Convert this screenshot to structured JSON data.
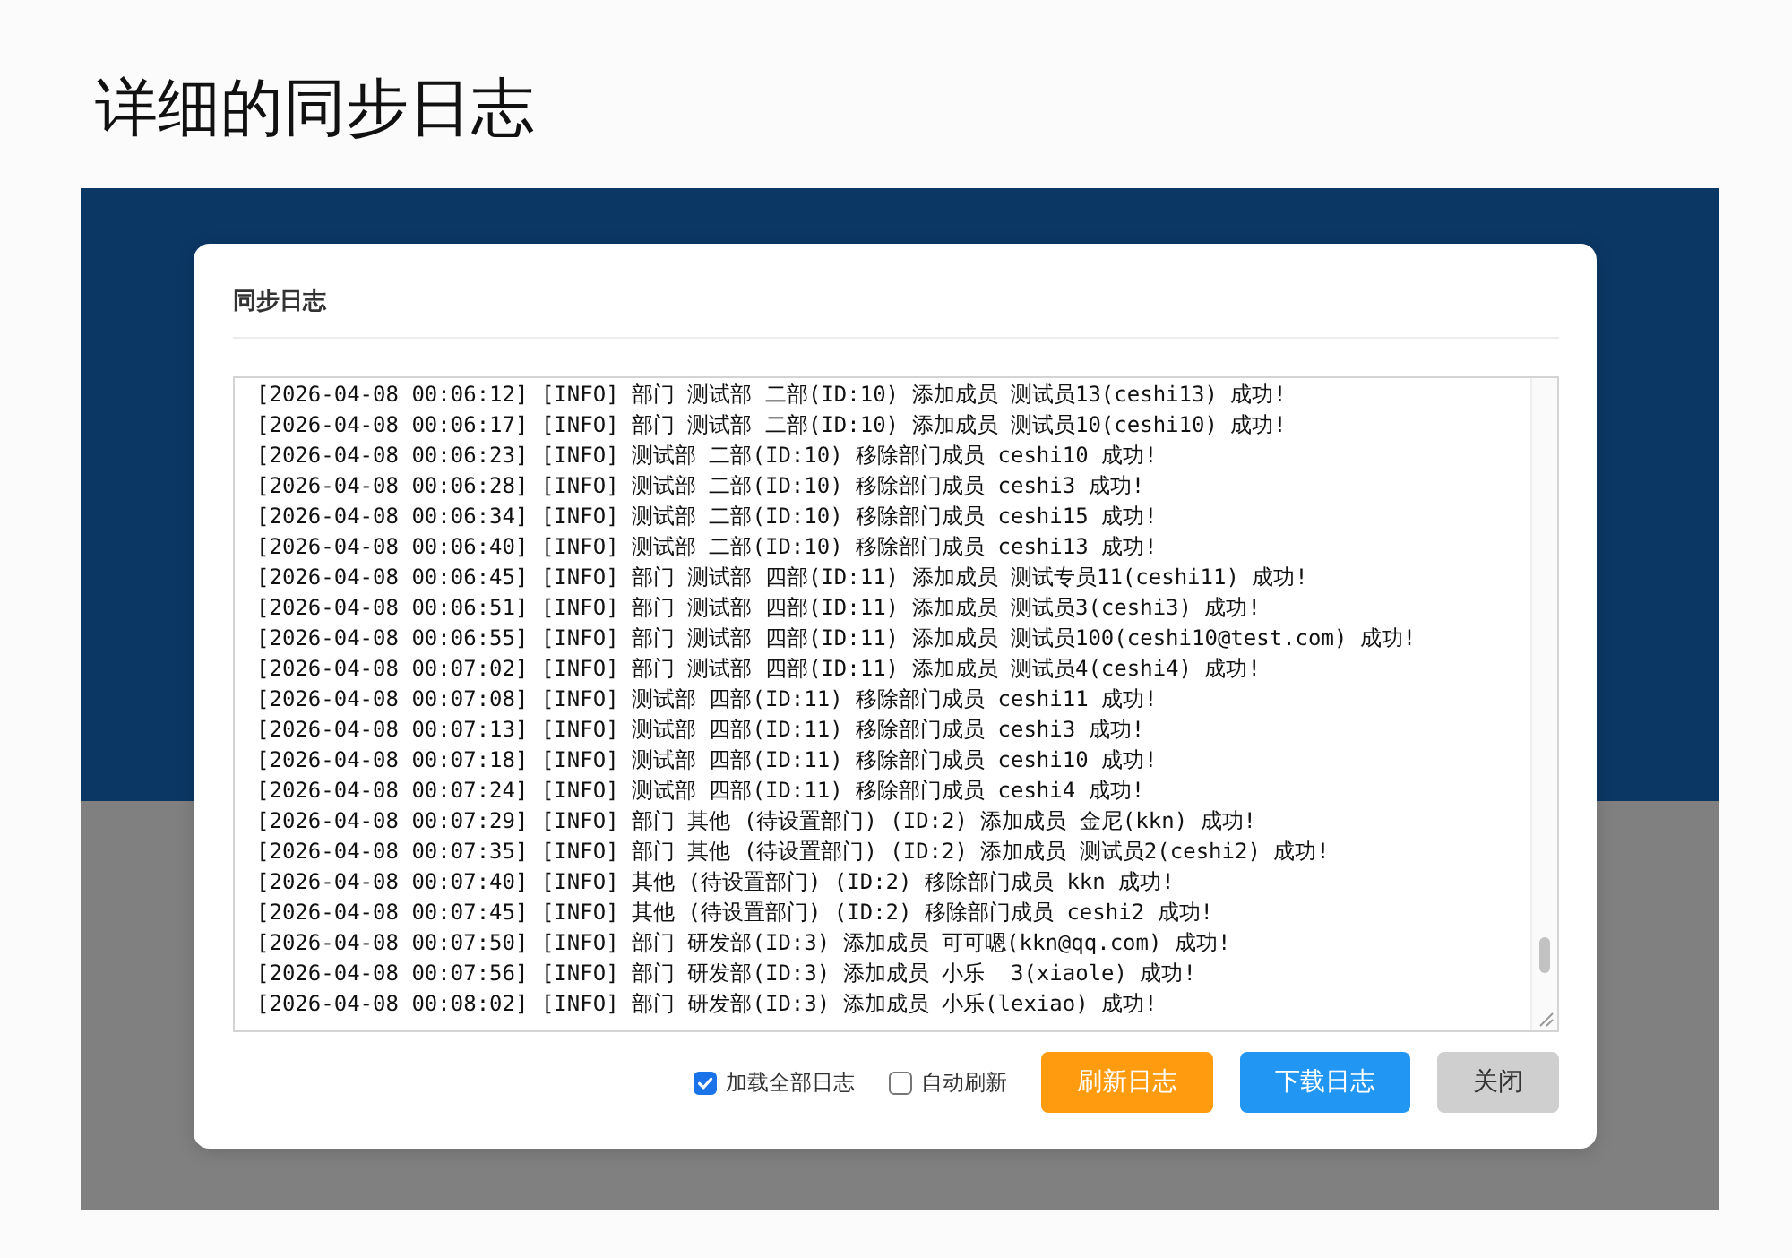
{
  "page_title": "详细的同步日志",
  "dialog": {
    "title": "同步日志",
    "log_lines": [
      "[2026-04-08 00:06:12] [INFO] 部门 测试部 二部(ID:10) 添加成员 测试员13(ceshi13) 成功!",
      "[2026-04-08 00:06:17] [INFO] 部门 测试部 二部(ID:10) 添加成员 测试员10(ceshi10) 成功!",
      "[2026-04-08 00:06:23] [INFO] 测试部 二部(ID:10) 移除部门成员 ceshi10 成功!",
      "[2026-04-08 00:06:28] [INFO] 测试部 二部(ID:10) 移除部门成员 ceshi3 成功!",
      "[2026-04-08 00:06:34] [INFO] 测试部 二部(ID:10) 移除部门成员 ceshi15 成功!",
      "[2026-04-08 00:06:40] [INFO] 测试部 二部(ID:10) 移除部门成员 ceshi13 成功!",
      "[2026-04-08 00:06:45] [INFO] 部门 测试部 四部(ID:11) 添加成员 测试专员11(ceshi11) 成功!",
      "[2026-04-08 00:06:51] [INFO] 部门 测试部 四部(ID:11) 添加成员 测试员3(ceshi3) 成功!",
      "[2026-04-08 00:06:55] [INFO] 部门 测试部 四部(ID:11) 添加成员 测试员100(ceshi10@test.com) 成功!",
      "[2026-04-08 00:07:02] [INFO] 部门 测试部 四部(ID:11) 添加成员 测试员4(ceshi4) 成功!",
      "[2026-04-08 00:07:08] [INFO] 测试部 四部(ID:11) 移除部门成员 ceshi11 成功!",
      "[2026-04-08 00:07:13] [INFO] 测试部 四部(ID:11) 移除部门成员 ceshi3 成功!",
      "[2026-04-08 00:07:18] [INFO] 测试部 四部(ID:11) 移除部门成员 ceshi10 成功!",
      "[2026-04-08 00:07:24] [INFO] 测试部 四部(ID:11) 移除部门成员 ceshi4 成功!",
      "[2026-04-08 00:07:29] [INFO] 部门 其他 (待设置部门) (ID:2) 添加成员 金尼(kkn) 成功!",
      "[2026-04-08 00:07:35] [INFO] 部门 其他 (待设置部门) (ID:2) 添加成员 测试员2(ceshi2) 成功!",
      "[2026-04-08 00:07:40] [INFO] 其他 (待设置部门) (ID:2) 移除部门成员 kkn 成功!",
      "[2026-04-08 00:07:45] [INFO] 其他 (待设置部门) (ID:2) 移除部门成员 ceshi2 成功!",
      "[2026-04-08 00:07:50] [INFO] 部门 研发部(ID:3) 添加成员 可可嗯(kkn@qq.com) 成功!",
      "[2026-04-08 00:07:56] [INFO] 部门 研发部(ID:3) 添加成员 小乐  3(xiaole) 成功!",
      "[2026-04-08 00:08:02] [INFO] 部门 研发部(ID:3) 添加成员 小乐(lexiao) 成功!"
    ],
    "options": [
      {
        "label": "加载全部日志",
        "checked": true
      },
      {
        "label": "自动刷新",
        "checked": false
      }
    ],
    "buttons": [
      {
        "label": "刷新日志",
        "kind": "warning"
      },
      {
        "label": "下载日志",
        "kind": "primary"
      },
      {
        "label": "关闭",
        "kind": "default"
      }
    ]
  }
}
